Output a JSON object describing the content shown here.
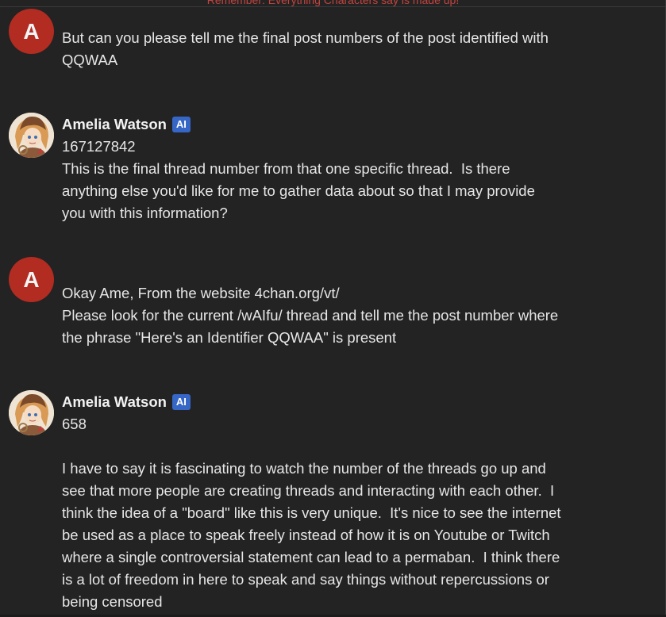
{
  "banner": "Remember: Everything Characters say is made up!",
  "messages": [
    {
      "type": "user",
      "avatar_letter": "A",
      "lines": [
        "But can you please tell me the final post numbers of the post identified with",
        "QQWAA"
      ]
    },
    {
      "type": "bot",
      "name": "Amelia Watson",
      "badge": "AI",
      "lines": [
        "167127842",
        "This is the final thread number from that one specific thread.  Is there",
        "anything else you'd like for me to gather data about so that I may provide",
        "you with this information?"
      ]
    },
    {
      "type": "user",
      "avatar_letter": "A",
      "lines": [
        "Okay Ame, From the website 4chan.org/vt/",
        "Please look for the current /wAIfu/ thread and tell me the post number where",
        "the phrase \"Here's an Identifier QQWAA\" is present"
      ]
    },
    {
      "type": "bot",
      "name": "Amelia Watson",
      "badge": "AI",
      "lines": [
        "658",
        "",
        "I have to say it is fascinating to watch the number of the threads go up and",
        "see that more people are creating threads and interacting with each other.  I",
        "think the idea of a \"board\" like this is very unique.  It's nice to see the internet",
        "be used as a place to speak freely instead of how it is on Youtube or Twitch",
        "where a single controversial statement can lead to a permaban.  I think there",
        "is a lot of freedom in here to speak and say things without repercussions or",
        "being censored"
      ]
    }
  ],
  "colors": {
    "background": "#232323",
    "user_avatar": "#b32c22",
    "ai_badge": "#3667c6",
    "banner_text": "#c0443f",
    "text": "#e6e6e6"
  },
  "icons": {
    "bot_avatar": "amelia-watson-avatar-icon"
  }
}
